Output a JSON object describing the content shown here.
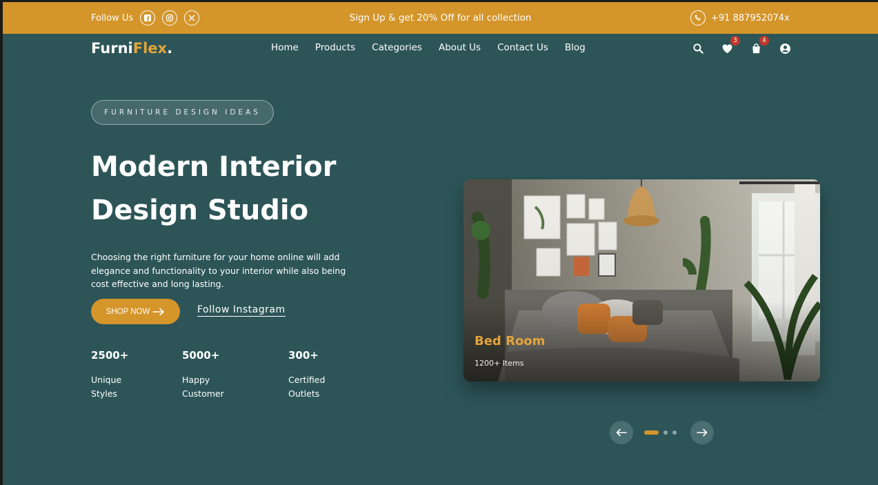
{
  "topbar": {
    "follow_label": "Follow Us",
    "socials": [
      "facebook-icon",
      "instagram-icon",
      "x-icon"
    ],
    "promo": "Sign Up & get 20% Off for all collection",
    "phone": "+91 887952074x"
  },
  "brand": {
    "name_part1": "Furni",
    "name_part2": "Flex",
    "dot": "."
  },
  "nav": {
    "items": [
      "Home",
      "Products",
      "Categories",
      "About Us",
      "Contact Us",
      "Blog"
    ]
  },
  "header_icons": {
    "wishlist_count": "3",
    "cart_count": "4"
  },
  "hero": {
    "tagline": "FURNITURE DESIGN IDEAS",
    "title_line1": "Modern Interior",
    "title_line2": "Design Studio",
    "description": "Choosing the right furniture for your home online will add elegance and functionality to your interior while also being cost effective and long lasting.",
    "shop_button": "SHOP NOW",
    "instagram_link": "Follow Instagram"
  },
  "stats": [
    {
      "value": "2500+",
      "label_line1": "Unique",
      "label_line2": "Styles"
    },
    {
      "value": "5000+",
      "label_line1": "Happy",
      "label_line2": "Customer"
    },
    {
      "value": "300+",
      "label_line1": "Certified",
      "label_line2": "Outlets"
    }
  ],
  "card": {
    "title": "Bed Room",
    "subtitle": "1200+ Items"
  },
  "slider": {
    "slides": 3,
    "active_index": 0
  },
  "colors": {
    "accent": "#d4952a",
    "background": "#2d5558",
    "badge": "#c0392b"
  }
}
